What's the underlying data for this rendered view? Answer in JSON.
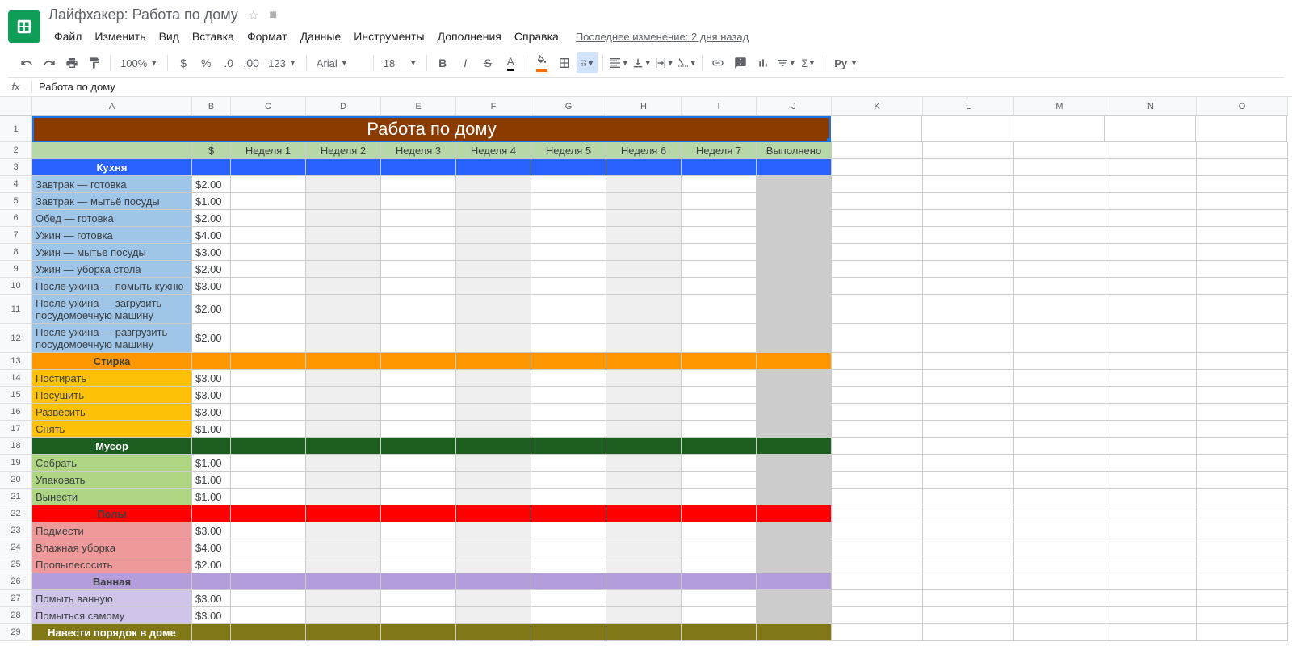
{
  "doc": {
    "title": "Лайфхакер: Работа по дому",
    "last_edit": "Последнее изменение: 2 дня назад"
  },
  "menu": {
    "file": "Файл",
    "edit": "Изменить",
    "view": "Вид",
    "insert": "Вставка",
    "format": "Формат",
    "data": "Данные",
    "tools": "Инструменты",
    "addons": "Дополнения",
    "help": "Справка"
  },
  "toolbar": {
    "zoom": "100%",
    "more_formats": "123",
    "font": "Arial",
    "size": "18",
    "py": "Py"
  },
  "formula": {
    "fx": "fx",
    "value": "Работа по дому"
  },
  "cols": [
    "A",
    "B",
    "C",
    "D",
    "E",
    "F",
    "G",
    "H",
    "I",
    "J",
    "K",
    "L",
    "M",
    "N",
    "O"
  ],
  "sheet": {
    "title": "Работа по дому",
    "hdr_price": "$",
    "weeks": [
      "Неделя 1",
      "Неделя 2",
      "Неделя 3",
      "Неделя 4",
      "Неделя 5",
      "Неделя 6",
      "Неделя 7"
    ],
    "done": "Выполнено",
    "sections": [
      {
        "cat": "Кухня",
        "cat_cls": "cat-kitchen",
        "task_cls": "task-kitchen",
        "tasks": [
          {
            "name": "Завтрак — готовка",
            "price": "$2.00"
          },
          {
            "name": "Завтрак — мытьё посуды",
            "price": "$1.00"
          },
          {
            "name": "Обед — готовка",
            "price": "$2.00"
          },
          {
            "name": "Ужин — готовка",
            "price": "$4.00"
          },
          {
            "name": "Ужин — мытье посуды",
            "price": "$3.00"
          },
          {
            "name": "Ужин — уборка стола",
            "price": "$2.00"
          },
          {
            "name": "После ужина — помыть кухню",
            "price": "$3.00"
          },
          {
            "name": "После ужина — загрузить посудомоечную машину",
            "price": "$2.00",
            "tall": true
          },
          {
            "name": "После ужина — разгрузить посудомоечную машину",
            "price": "$2.00",
            "tall": true
          }
        ]
      },
      {
        "cat": "Стирка",
        "cat_cls": "cat-laundry",
        "task_cls": "task-laundry",
        "tasks": [
          {
            "name": "Постирать",
            "price": "$3.00"
          },
          {
            "name": "Посушить",
            "price": "$3.00"
          },
          {
            "name": "Развесить",
            "price": "$3.00"
          },
          {
            "name": "Снять",
            "price": "$1.00"
          }
        ]
      },
      {
        "cat": "Мусор",
        "cat_cls": "cat-trash",
        "task_cls": "task-trash",
        "tasks": [
          {
            "name": "Собрать",
            "price": "$1.00"
          },
          {
            "name": "Упаковать",
            "price": "$1.00"
          },
          {
            "name": "Вынести",
            "price": "$1.00"
          }
        ]
      },
      {
        "cat": "Полы",
        "cat_cls": "cat-floor",
        "task_cls": "task-floor",
        "tasks": [
          {
            "name": "Подмести",
            "price": "$3.00"
          },
          {
            "name": "Влажная уборка",
            "price": "$4.00"
          },
          {
            "name": "Пропылесосить",
            "price": "$2.00"
          }
        ]
      },
      {
        "cat": "Ванная",
        "cat_cls": "cat-bath",
        "task_cls": "task-bath",
        "tasks": [
          {
            "name": "Помыть ванную",
            "price": "$3.00"
          },
          {
            "name": "Помыться самому",
            "price": "$3.00"
          }
        ]
      },
      {
        "cat": "Навести порядок в доме",
        "cat_cls": "cat-house",
        "task_cls": "",
        "tasks": []
      }
    ]
  }
}
